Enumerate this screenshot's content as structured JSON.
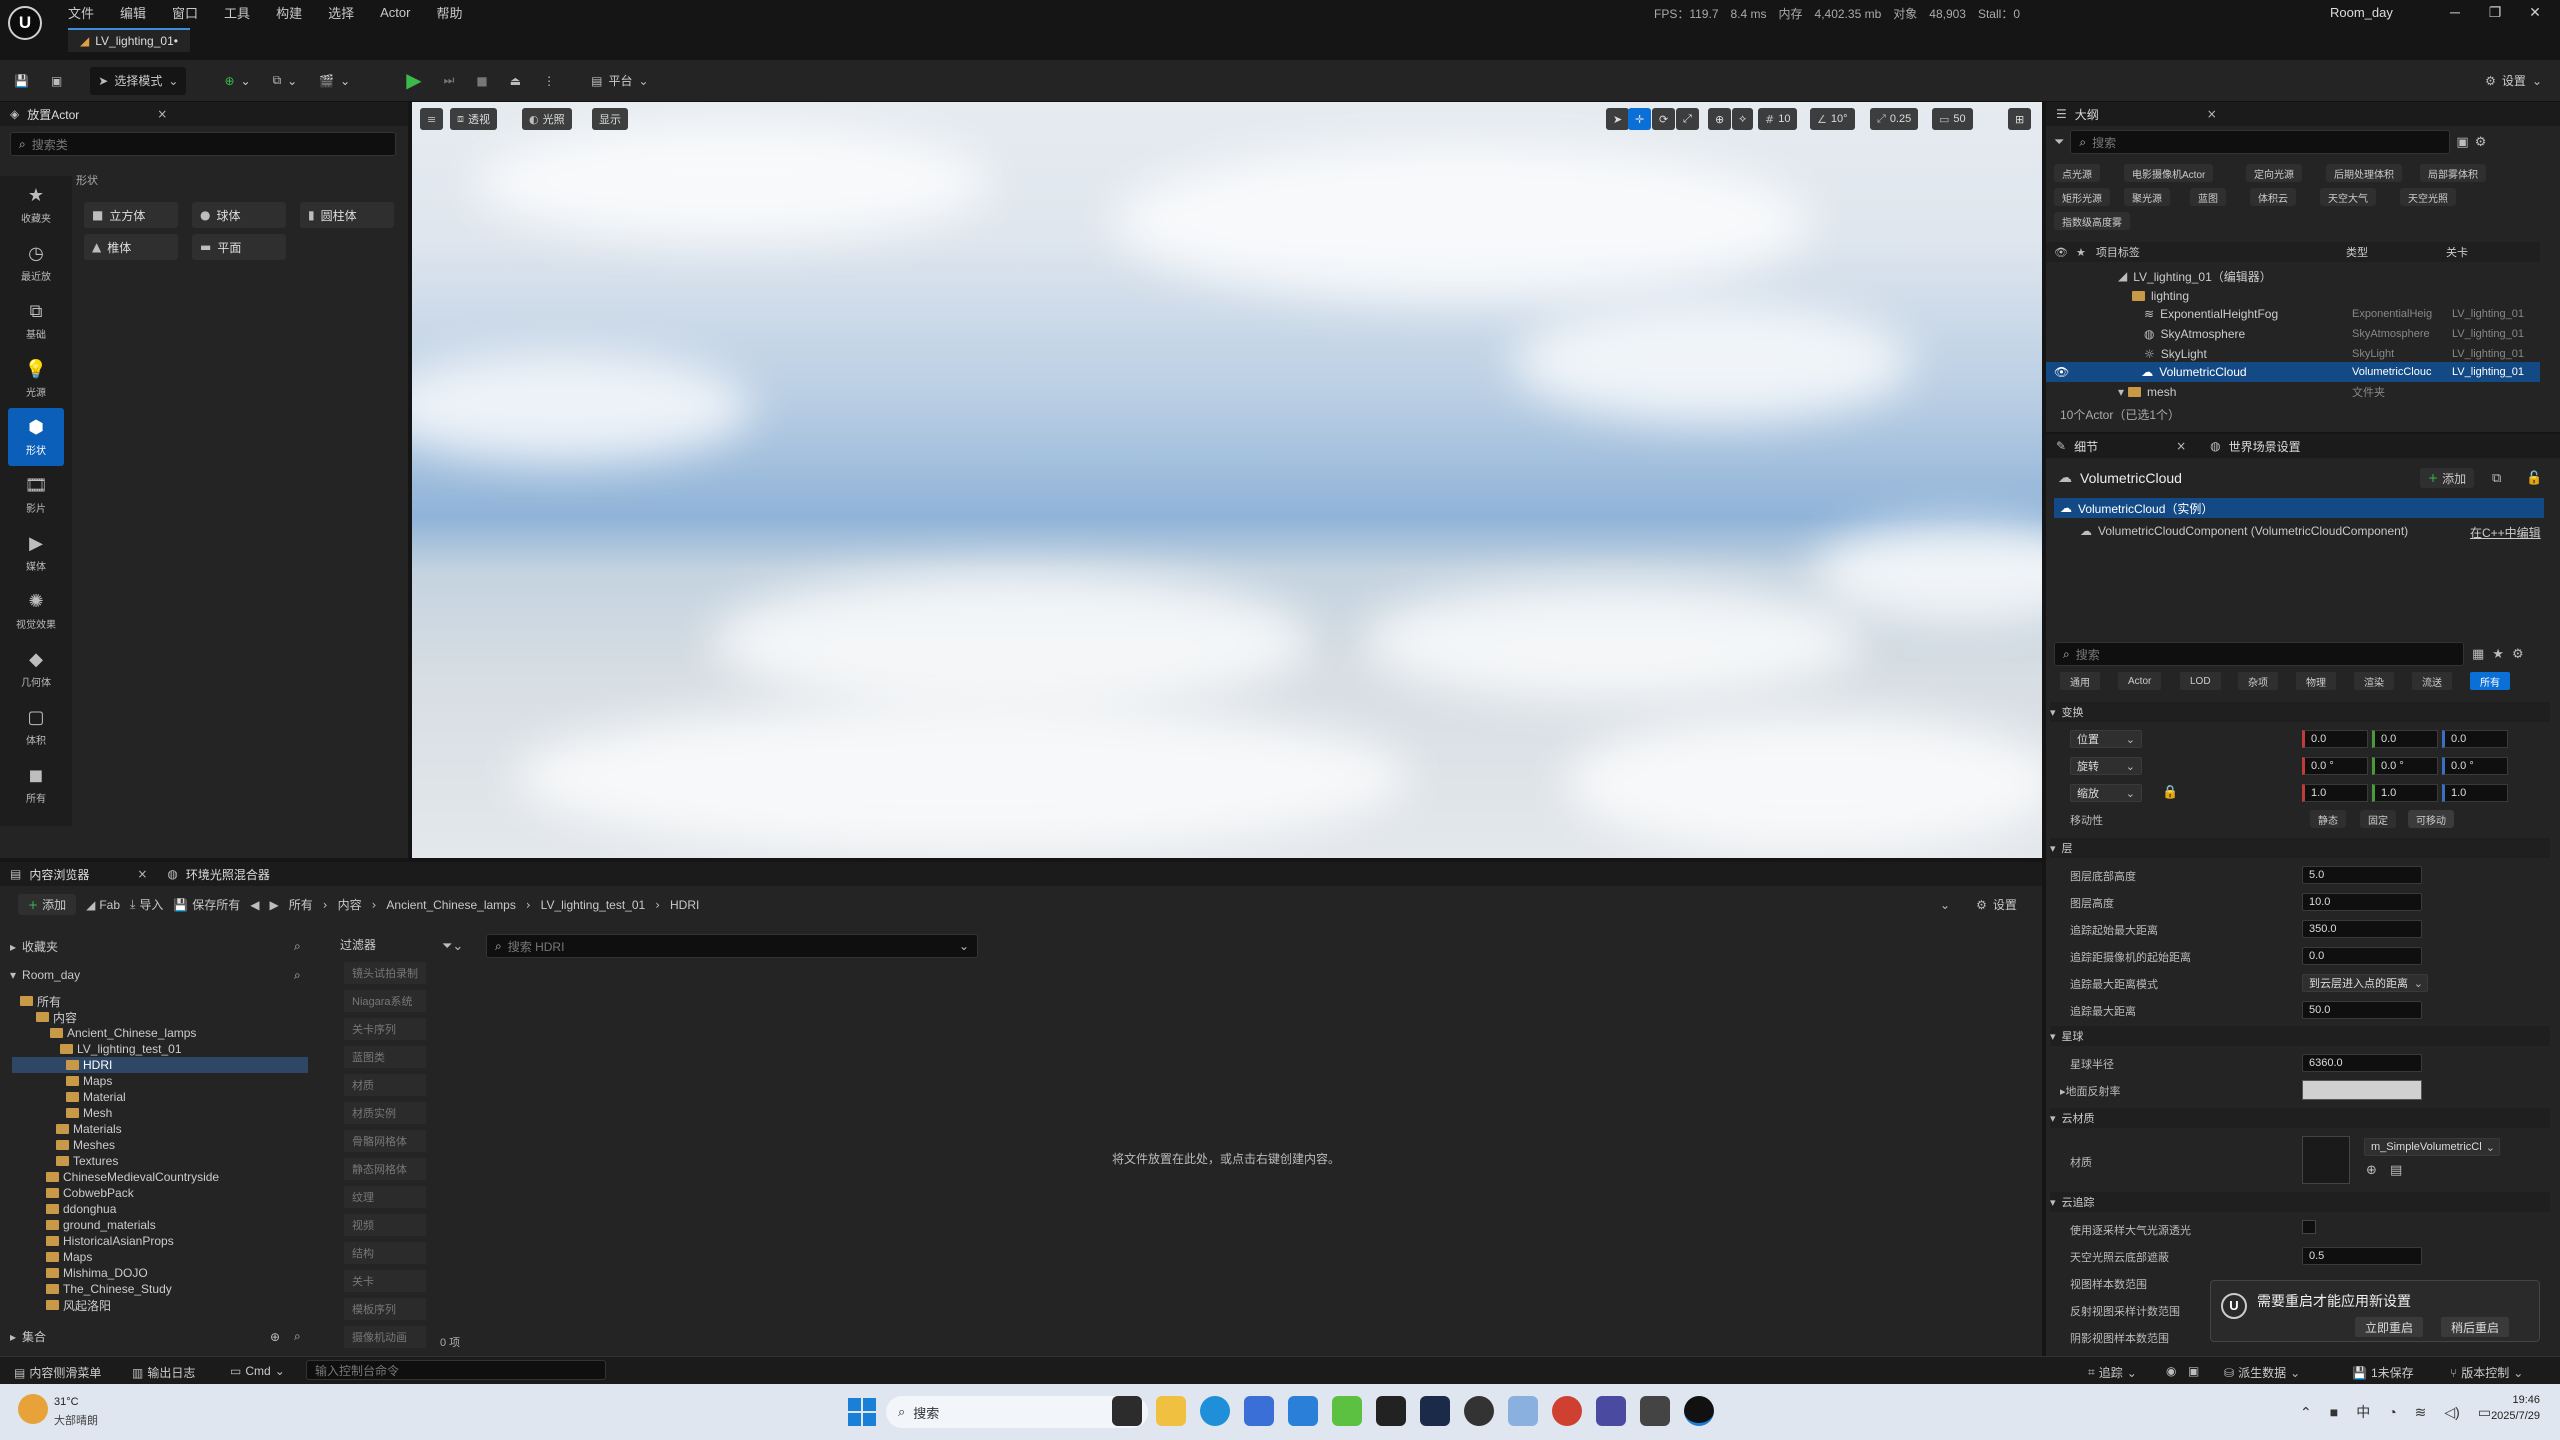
{
  "menubar": {
    "logo": "U",
    "items": [
      "文件",
      "编辑",
      "窗口",
      "工具",
      "构建",
      "选择",
      "Actor",
      "帮助"
    ],
    "level_tab": "LV_lighting_01•",
    "stats": [
      "FPS：119.7",
      "8.4 ms",
      "内存",
      "4,402.35 mb",
      "对象",
      "48,903",
      "Stall：0"
    ],
    "level_name": "Room_day"
  },
  "toolbar": {
    "select_mode": "选择模式",
    "platform": "平台",
    "settings": "设置"
  },
  "place_actor": {
    "title": "放置Actor",
    "search_placeholder": "搜索类",
    "section": "形状",
    "categories": [
      "收藏夹",
      "最近放",
      "基础",
      "光源",
      "形状",
      "影片",
      "媒体",
      "视觉效果",
      "几何体",
      "体积",
      "所有"
    ],
    "shapes": [
      "立方体",
      "球体",
      "圆柱体",
      "椎体",
      "平面"
    ]
  },
  "viewport": {
    "buttons": [
      "透视",
      "光照",
      "显示"
    ],
    "snap_grid": "10",
    "snap_angle": "10°",
    "snap_scale": "0.25",
    "camera_speed": "50"
  },
  "outliner": {
    "title": "大纲",
    "search_placeholder": "搜索",
    "chips": [
      "点光源",
      "电影摄像机Actor",
      "定向光源",
      "后期处理体积",
      "局部雾体积",
      "矩形光源",
      "聚光源",
      "蓝图",
      "体积云",
      "天空大气",
      "天空光照",
      "指数级高度雾"
    ],
    "col_label": "项目标签",
    "col_type": "类型",
    "col_level": "关卡",
    "rows": [
      {
        "label": "LV_lighting_01（编辑器）",
        "type": "",
        "level": ""
      },
      {
        "label": "lighting",
        "type": "",
        "level": ""
      },
      {
        "label": "ExponentialHeightFog",
        "type": "ExponentialHeig",
        "level": "LV_lighting_01"
      },
      {
        "label": "SkyAtmosphere",
        "type": "SkyAtmosphere",
        "level": "LV_lighting_01"
      },
      {
        "label": "SkyLight",
        "type": "SkyLight",
        "level": "LV_lighting_01"
      },
      {
        "label": "VolumetricCloud",
        "type": "VolumetricClouc",
        "level": "LV_lighting_01"
      },
      {
        "label": "mesh",
        "type": "文件夹",
        "level": ""
      }
    ],
    "count": "10个Actor（已选1个）"
  },
  "details": {
    "tab_details": "细节",
    "tab_world": "世界场景设置",
    "actor_name": "VolumetricCloud",
    "add_label": "添加",
    "instance": "VolumetricCloud（实例）",
    "component": "VolumetricCloudComponent (VolumetricCloudComponent)",
    "edit_cpp": "在C++中编辑",
    "search_placeholder": "搜索",
    "tabs": [
      "通用",
      "Actor",
      "LOD",
      "杂项",
      "物理",
      "渲染",
      "流送",
      "所有"
    ],
    "transform": {
      "section": "变换",
      "location_label": "位置",
      "rotation_label": "旋转",
      "scale_label": "缩放",
      "location": [
        "0.0",
        "0.0",
        "0.0"
      ],
      "rotation": [
        "0.0 °",
        "0.0 °",
        "0.0 °"
      ],
      "scale": [
        "1.0",
        "1.0",
        "1.0"
      ],
      "mobility_label": "移动性",
      "mobility": [
        "静态",
        "固定",
        "可移动"
      ]
    },
    "layer": {
      "section": "层",
      "props": [
        {
          "label": "图层底部高度",
          "value": "5.0"
        },
        {
          "label": "图层高度",
          "value": "10.0"
        },
        {
          "label": "追踪起始最大距离",
          "value": "350.0"
        },
        {
          "label": "追踪距摄像机的起始距离",
          "value": "0.0"
        },
        {
          "label": "追踪最大距离模式",
          "value": "到云层进入点的距离"
        },
        {
          "label": "追踪最大距离",
          "value": "50.0"
        }
      ]
    },
    "planet": {
      "section": "星球",
      "radius_label": "星球半径",
      "radius": "6360.0",
      "albedo_label": "地面反射率"
    },
    "cloud_material": {
      "section": "云材质",
      "material_label": "材质",
      "material_value": "m_SimpleVolumetricCl"
    },
    "cloud_tracing": {
      "section": "云追踪",
      "props": [
        "使用逐采样大气光源透光",
        "天空光照云底部遮蔽",
        "视图样本数范围",
        "反射视图采样计数范围",
        "阴影视图样本数范围"
      ],
      "sky_occlusion": "0.5"
    }
  },
  "content_browser": {
    "tab": "内容浏览器",
    "tab2": "环境光照混合器",
    "add": "添加",
    "fab": "Fab",
    "import": "导入",
    "save_all": "保存所有",
    "breadcrumb": [
      "所有",
      "内容",
      "Ancient_Chinese_lamps",
      "LV_lighting_test_01",
      "HDRI"
    ],
    "settings": "设置",
    "favorites": "收藏夹",
    "project": "Room_day",
    "filters_label": "过滤器",
    "search_placeholder": "搜索 HDRI",
    "tree": [
      {
        "label": "所有",
        "depth": 0
      },
      {
        "label": "内容",
        "depth": 1
      },
      {
        "label": "Ancient_Chinese_lamps",
        "depth": 2
      },
      {
        "label": "LV_lighting_test_01",
        "depth": 3
      },
      {
        "label": "HDRI",
        "depth": 4
      },
      {
        "label": "Maps",
        "depth": 4
      },
      {
        "label": "Material",
        "depth": 4
      },
      {
        "label": "Mesh",
        "depth": 4
      },
      {
        "label": "Materials",
        "depth": 3
      },
      {
        "label": "Meshes",
        "depth": 3
      },
      {
        "label": "Textures",
        "depth": 3
      },
      {
        "label": "ChineseMedievalCountryside",
        "depth": 2
      },
      {
        "label": "CobwebPack",
        "depth": 2
      },
      {
        "label": "ddonghua",
        "depth": 2
      },
      {
        "label": "ground_materials",
        "depth": 2
      },
      {
        "label": "HistoricalAsianProps",
        "depth": 2
      },
      {
        "label": "Maps",
        "depth": 2
      },
      {
        "label": "Mishima_DOJO",
        "depth": 2
      },
      {
        "label": "The_Chinese_Study",
        "depth": 2
      },
      {
        "label": "风起洛阳",
        "depth": 2
      }
    ],
    "filters": [
      "镜头试拍录制",
      "Niagara系统",
      "关卡序列",
      "蓝图类",
      "材质",
      "材质实例",
      "骨骼网格体",
      "静态网格体",
      "纹理",
      "视频",
      "结构",
      "关卡",
      "模板序列",
      "摄像机动画"
    ],
    "empty_msg": "将文件放置在此处，或点击右键创建内容。",
    "item_count": "0 项",
    "collections": "集合"
  },
  "statusbar": {
    "drawer": "内容侧滑菜单",
    "output": "输出日志",
    "cmd": "Cmd",
    "console_placeholder": "输入控制台命令",
    "trace": "追踪",
    "derived": "派生数据",
    "unsaved": "1未保存",
    "source_control": "版本控制"
  },
  "notification": {
    "message": "需要重启才能应用新设置",
    "restart_now": "立即重启",
    "restart_later": "稍后重启"
  },
  "taskbar": {
    "weather_temp": "31°C",
    "weather_desc": "大部晴朗",
    "search": "搜索",
    "time": "19:46",
    "date": "2025/7/29"
  }
}
